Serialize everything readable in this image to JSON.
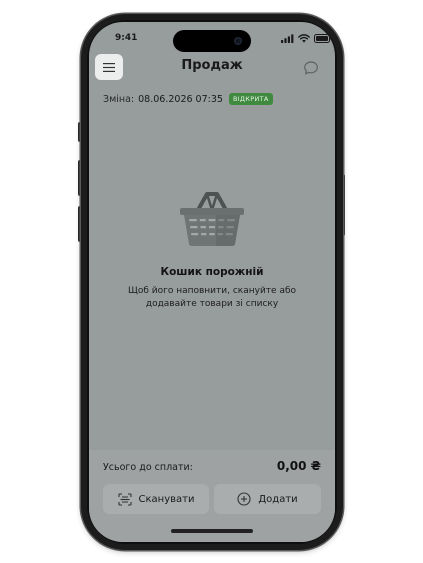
{
  "status_bar": {
    "time": "9:41"
  },
  "header": {
    "title": "Продаж"
  },
  "shift": {
    "label": "Зміна:",
    "datetime": "08.06.2026 07:35",
    "status": "ВІДКРИТА"
  },
  "empty_state": {
    "title": "Кошик порожній",
    "line1": "Щоб його наповнити, скануйте або",
    "line2": "додавайте товари зі списку"
  },
  "footer": {
    "total_label": "Усього до сплати:",
    "total_value": "0,00 ₴",
    "scan_label": "Сканувати",
    "add_label": "Додати"
  },
  "colors": {
    "screen_bg": "#979c9c",
    "badge": "#3f8a3f",
    "basket": "#5b6060"
  },
  "icons": {
    "menu": "hamburger-icon",
    "chat": "chat-bubble-icon",
    "basket": "basket-icon",
    "scan": "barcode-scan-icon",
    "add": "plus-circle-icon"
  }
}
